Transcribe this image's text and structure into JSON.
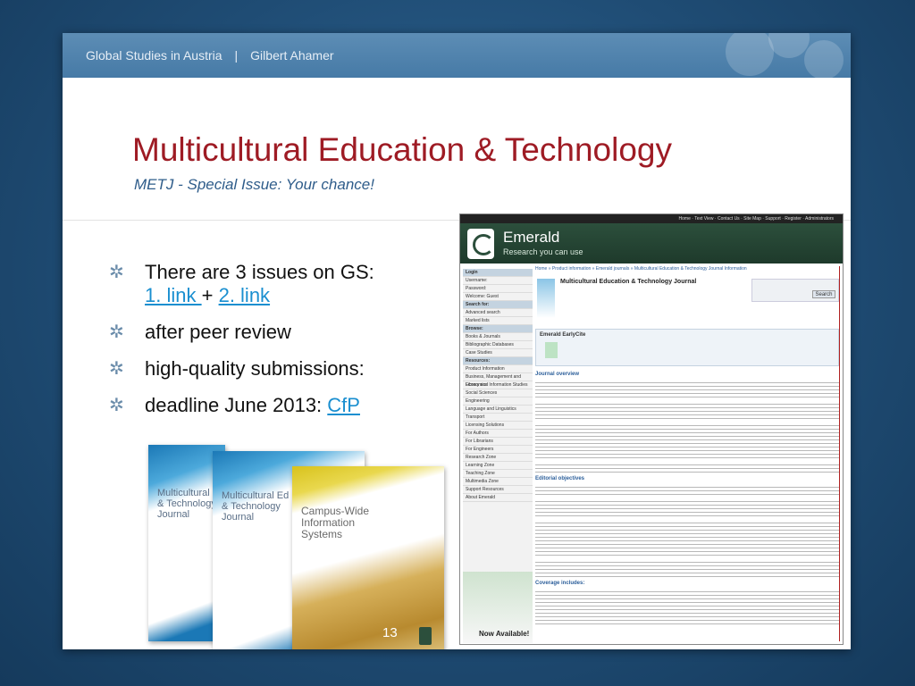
{
  "header": {
    "org": "Global Studies in Austria",
    "separator": "|",
    "author": "Gilbert Ahamer"
  },
  "title": "Multicultural Education & Technology",
  "subtitle": "METJ - Special Issue: Your chance!",
  "bullets": {
    "b1_text": "There are 3 issues on GS:",
    "link1": "1. link ",
    "plus": "+",
    "link2": "2. link",
    "b2": "after peer review",
    "b3": "high-quality submissions:",
    "b4_text": "deadline June 2013: ",
    "cfp": "CfP"
  },
  "covers": [
    {
      "title_lines": [
        "Multicultural",
        "& Technology",
        "Journal"
      ]
    },
    {
      "title_lines": [
        "Multicultural Ed",
        "& Technology",
        "Journal"
      ]
    },
    {
      "title_lines": [
        "Campus-Wide",
        "Information",
        "Systems"
      ]
    }
  ],
  "page_number": "13",
  "website": {
    "brand": "Emerald",
    "tagline": "Research you can use",
    "journal_title": "Multicultural Education & Technology Journal",
    "search_button": "Search",
    "earlycite_title": "Emerald EarlyCite",
    "section_overview": "Journal overview",
    "section_objectives": "Editorial objectives",
    "section_coverage": "Coverage includes:",
    "now_available": "Now Available!",
    "sidebar": [
      "Login",
      "Username:",
      "Password:",
      "Welcome: Guest",
      "Search for:",
      "Advanced search",
      "Marked lists",
      "Browse:",
      "Books & Journals",
      "Bibliographic Databases",
      "Case Studies",
      "Resources:",
      "Product Information",
      "Business, Management and Economics",
      "Library and Information Studies",
      "Social Sciences",
      "Engineering",
      "Language and Linguistics",
      "Transport",
      "Licensing Solutions",
      "For Authors",
      "For Librarians",
      "For Engineers",
      "Research Zone",
      "Learning Zone",
      "Teaching Zone",
      "Multimedia Zone",
      "Support Resources",
      "About Emerald"
    ]
  },
  "colors": {
    "title": "#9e1b24",
    "link": "#1a8fd0",
    "header": "#467aa6",
    "background": "#1f4c74"
  }
}
